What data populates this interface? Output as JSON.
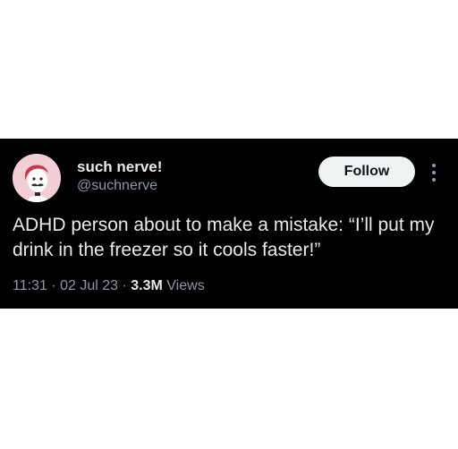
{
  "tweet": {
    "author": {
      "display_name": "such nerve!",
      "handle": "@suchnerve",
      "avatar_icon": "avatar-icon"
    },
    "follow_label": "Follow",
    "more_icon": "more-vertical-icon",
    "text": "ADHD person about to make a mistake: “I’ll put my drink in the freezer so it cools faster!”",
    "time": "11:31",
    "separator": "·",
    "date": "02 Jul 23",
    "views_count": "3.3M",
    "views_label": "Views"
  },
  "colors": {
    "card_background": "#000000",
    "page_background": "#ffffff",
    "primary_text": "#e7e9ea",
    "secondary_text": "#8b98a5",
    "follow_button_bg": "#eff3f4",
    "avatar_bg": "#f2cfd6"
  }
}
